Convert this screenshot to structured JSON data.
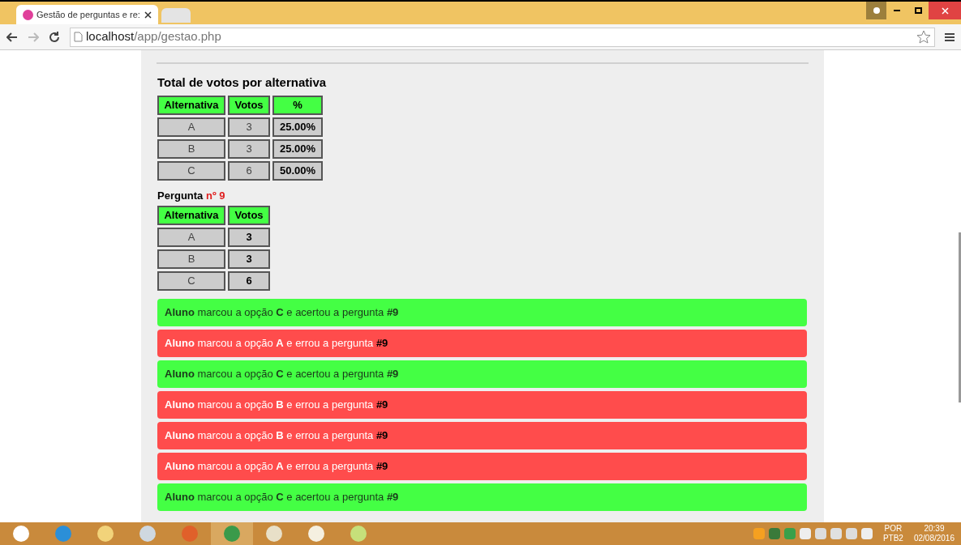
{
  "browser": {
    "tab_title": "Gestão de perguntas e re:",
    "url_host": "localhost",
    "url_path": "/app/gestao.php"
  },
  "totals": {
    "title": "Total de votos por alternativa",
    "columns": [
      "Alternativa",
      "Votos",
      "%"
    ],
    "rows": [
      [
        "A",
        "3",
        "25.00%"
      ],
      [
        "B",
        "3",
        "25.00%"
      ],
      [
        "C",
        "6",
        "50.00%"
      ]
    ]
  },
  "question": {
    "label": "Pergunta",
    "number": "nº 9",
    "columns": [
      "Alternativa",
      "Votos"
    ],
    "rows": [
      [
        "A",
        "3"
      ],
      [
        "B",
        "3"
      ],
      [
        "C",
        "6"
      ]
    ]
  },
  "answers": [
    {
      "kind": "correct",
      "text": "**Aluno** marcou a opção **C** e acertou a pergunta **#9**"
    },
    {
      "kind": "wrong",
      "text": "**Aluno** marcou a opção **A** e errou a pergunta **#9**"
    },
    {
      "kind": "correct",
      "text": "**Aluno** marcou a opção **C** e acertou a pergunta **#9**"
    },
    {
      "kind": "wrong",
      "text": "**Aluno** marcou a opção **B** e errou a pergunta **#9**"
    },
    {
      "kind": "wrong",
      "text": "**Aluno** marcou a opção **B** e errou a pergunta **#9**"
    },
    {
      "kind": "wrong",
      "text": "**Aluno** marcou a opção **A** e errou a pergunta **#9**"
    },
    {
      "kind": "correct",
      "text": "**Aluno** marcou a opção **C** e acertou a pergunta **#9**"
    }
  ],
  "taskbar": {
    "language": "POR",
    "layout": "PTB2",
    "time": "20:39",
    "date": "02/08/2016"
  }
}
